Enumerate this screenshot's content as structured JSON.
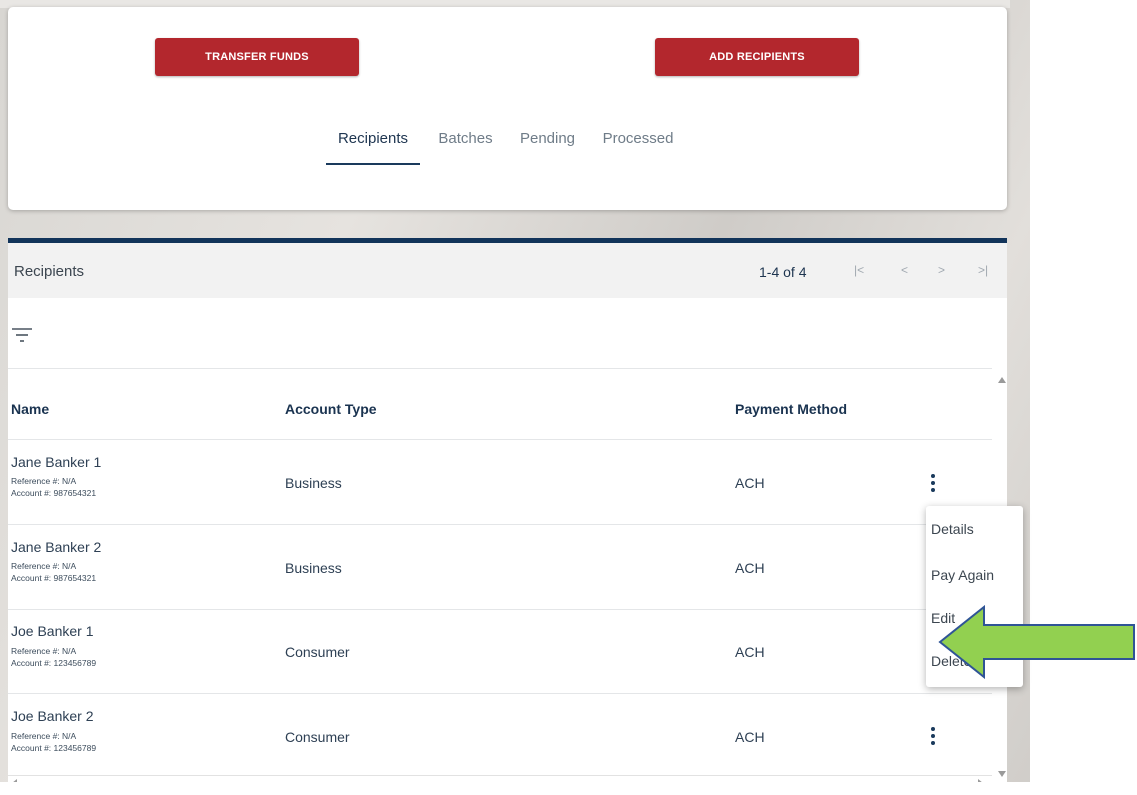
{
  "actions": {
    "transfer_label": "TRANSFER FUNDS",
    "add_label": "ADD RECIPIENTS"
  },
  "tabs": [
    {
      "label": "Recipients",
      "active": true
    },
    {
      "label": "Batches",
      "active": false
    },
    {
      "label": "Pending",
      "active": false
    },
    {
      "label": "Processed",
      "active": false
    }
  ],
  "panel": {
    "title": "Recipients",
    "page_count": "1-4 of 4",
    "pager": {
      "first": "|<",
      "prev": "<",
      "next": ">",
      "last": ">|"
    }
  },
  "table": {
    "headers": {
      "name": "Name",
      "account_type": "Account Type",
      "payment_method": "Payment Method"
    },
    "rows": [
      {
        "name": "Jane Banker 1",
        "reference": "Reference #: N/A",
        "account": "Account #: 987654321",
        "account_type": "Business",
        "payment_method": "ACH"
      },
      {
        "name": "Jane Banker 2",
        "reference": "Reference #: N/A",
        "account": "Account #: 987654321",
        "account_type": "Business",
        "payment_method": "ACH"
      },
      {
        "name": "Joe Banker 1",
        "reference": "Reference #: N/A",
        "account": "Account #: 123456789",
        "account_type": "Consumer",
        "payment_method": "ACH"
      },
      {
        "name": "Joe Banker 2",
        "reference": "Reference #: N/A",
        "account": "Account #: 123456789",
        "account_type": "Consumer",
        "payment_method": "ACH"
      }
    ]
  },
  "row_menu": {
    "items": [
      "Details",
      "Pay Again",
      "Edit",
      "Delete"
    ]
  },
  "icons": {
    "filter": "filter-icon",
    "row_actions": "more-vertical-icon",
    "pointer": "arrow-left-icon"
  },
  "colors": {
    "primary_red": "#b3272d",
    "navy": "#12345a",
    "arrow_fill": "#92d050",
    "arrow_stroke": "#2f5496"
  }
}
